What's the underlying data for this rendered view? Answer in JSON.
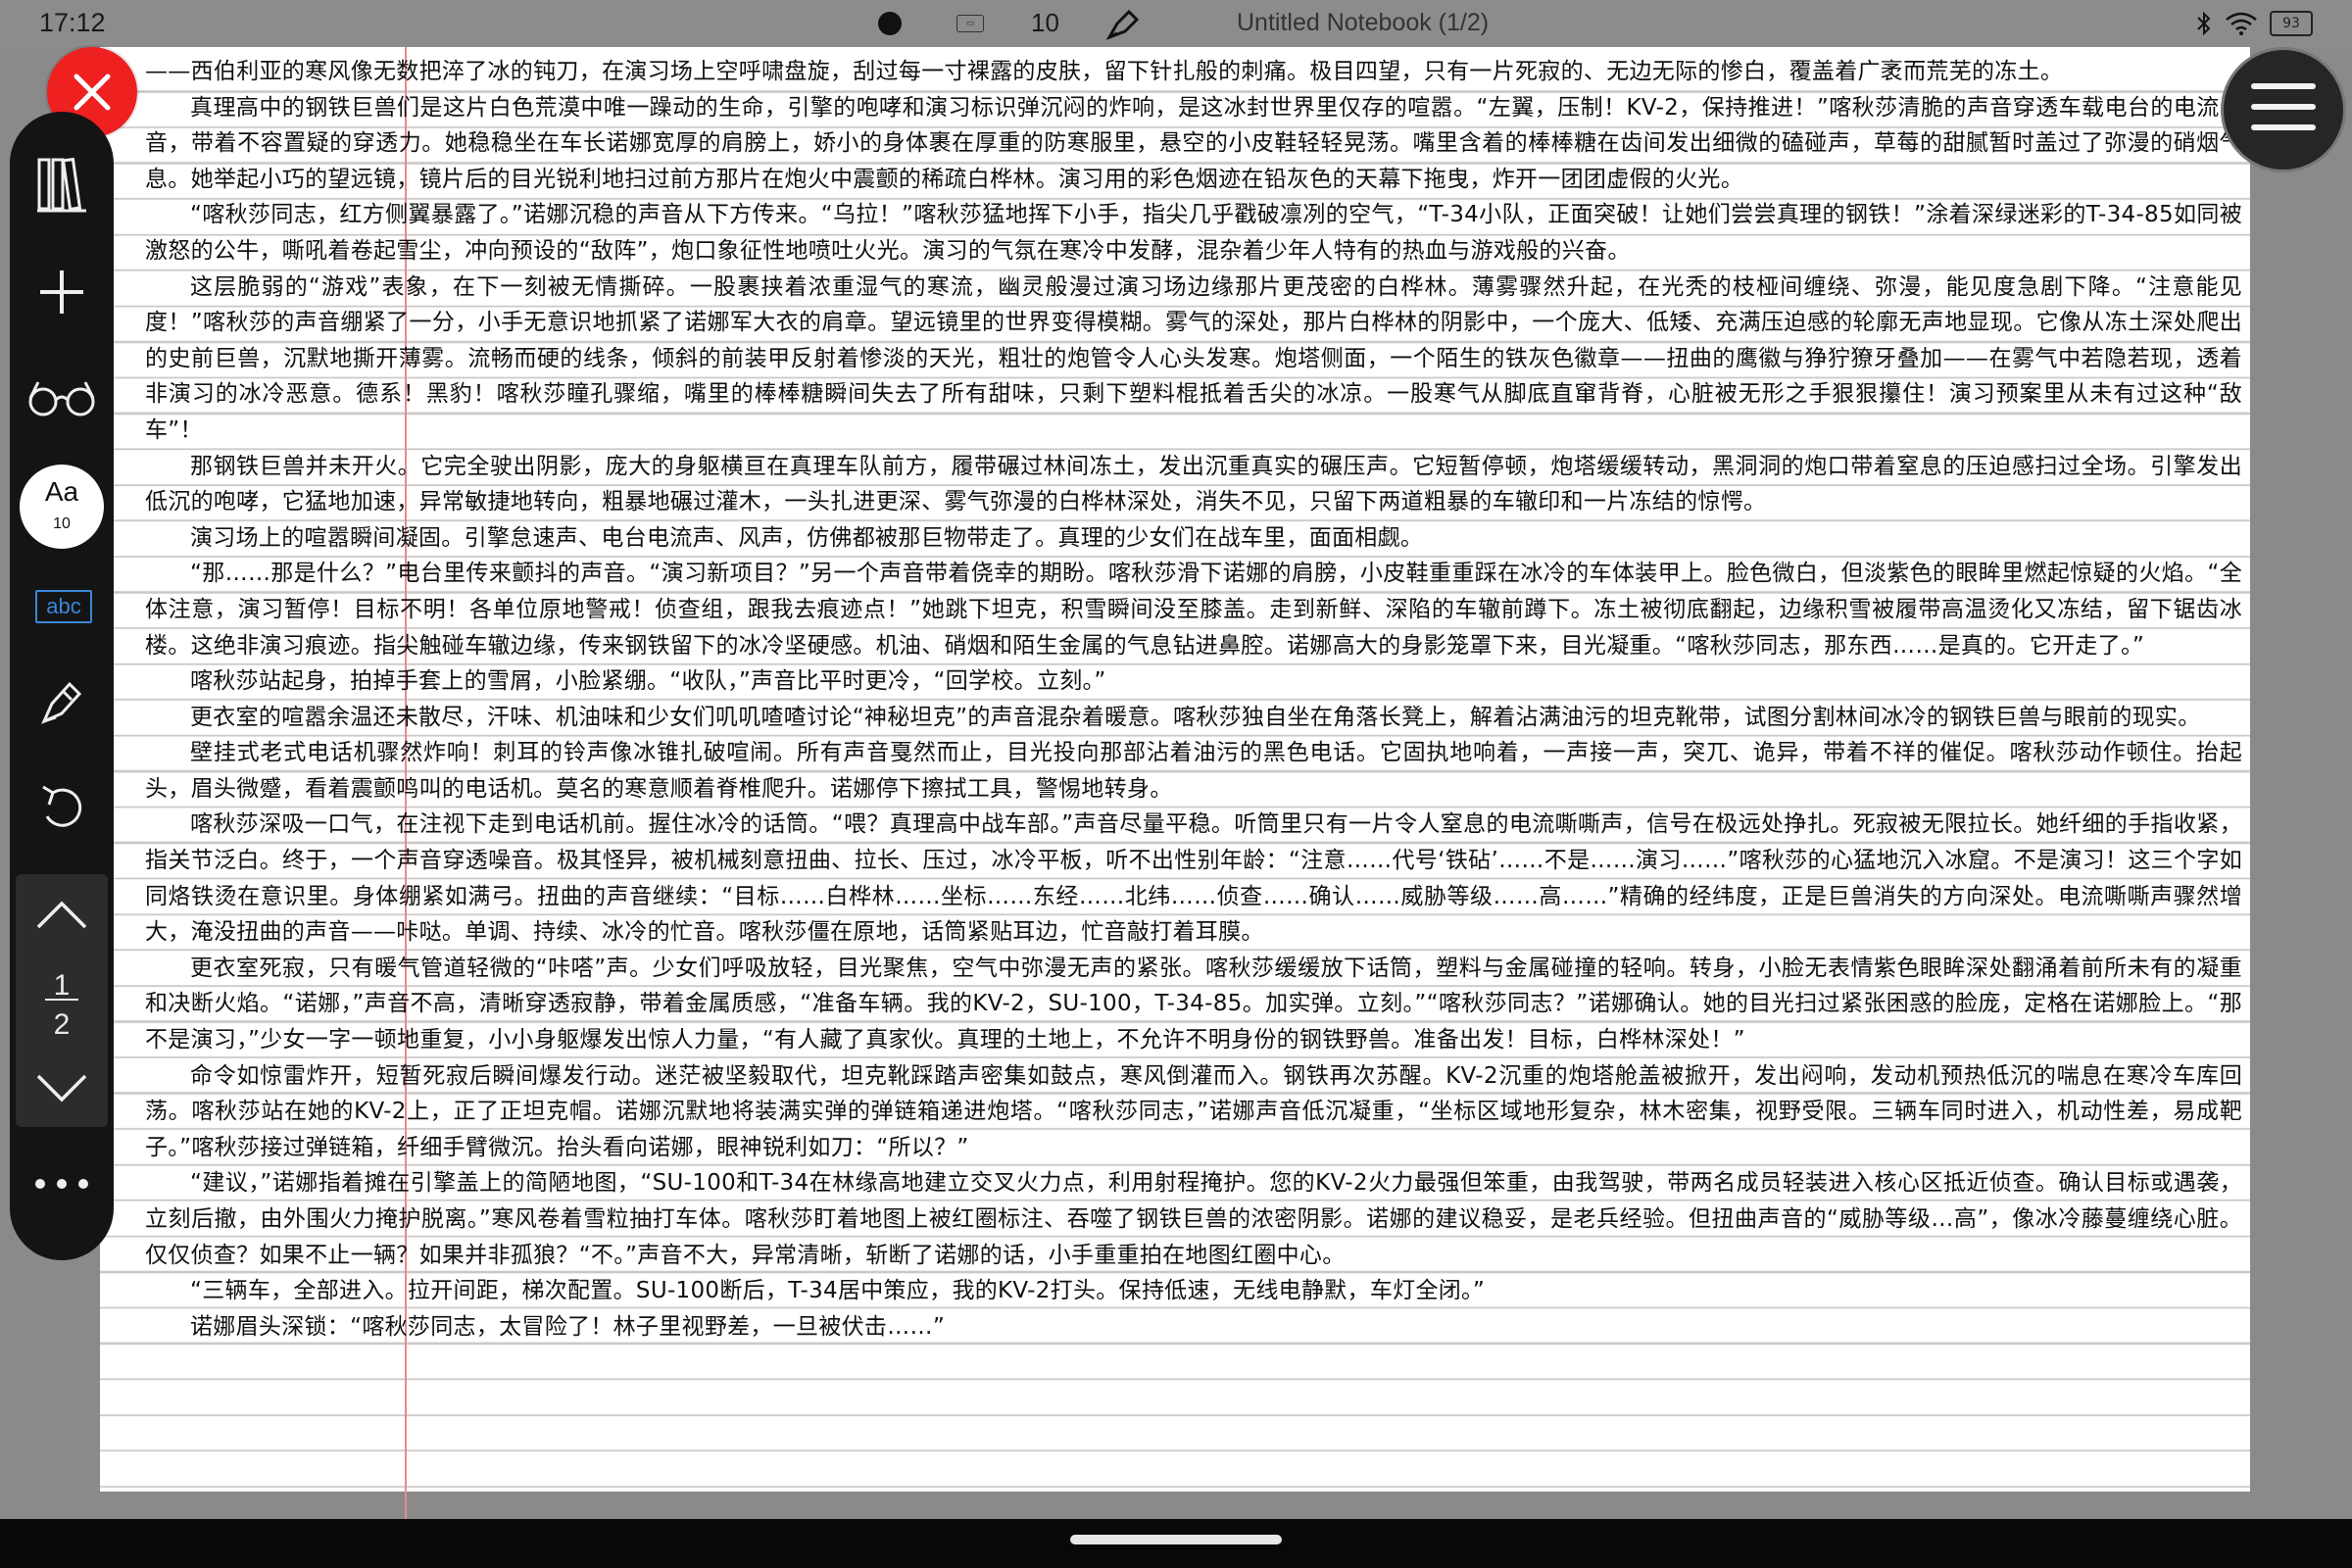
{
  "status": {
    "time": "17:12",
    "pen_count": "10",
    "notebook_title": "Untitled Notebook (1/2)",
    "battery": "93"
  },
  "toolbar": {
    "font_label": "Aa",
    "font_size": "10",
    "text_mode_label": "abc",
    "page_current": "1",
    "page_total": "2"
  },
  "colors": {
    "close": "#ee2020",
    "margin_line": "#e88b8b",
    "accent": "#3b86d6"
  },
  "icons": [
    "close-icon",
    "menu-icon",
    "library-icon",
    "add-icon",
    "glasses-icon",
    "pen-icon",
    "undo-icon",
    "chevron-up-icon",
    "chevron-down-icon",
    "more-icon",
    "bluetooth-icon",
    "wifi-icon",
    "battery-icon",
    "keyboard-icon"
  ],
  "document": {
    "paragraphs": [
      "——西伯利亚的寒风像无数把淬了冰的钝刀，在演习场上空呼啸盘旋，刮过每一寸裸露的皮肤，留下针扎般的刺痛。极目四望，只有一片死寂的、无边无际的惨白，覆盖着广袤而荒芜的冻土。",
      "真理高中的钢铁巨兽们是这片白色荒漠中唯一躁动的生命，引擎的咆哮和演习标识弹沉闷的炸响，是这冰封世界里仅存的喧嚣。“左翼，压制！KV-2，保持推进！”喀秋莎清脆的声音穿透车载电台的电流杂音，带着不容置疑的穿透力。她稳稳坐在车长诺娜宽厚的肩膀上，娇小的身体裹在厚重的防寒服里，悬空的小皮鞋轻轻晃荡。嘴里含着的棒棒糖在齿间发出细微的磕碰声，草莓的甜腻暂时盖过了弥漫的硝烟气息。她举起小巧的望远镜，镜片后的目光锐利地扫过前方那片在炮火中震颤的稀疏白桦林。演习用的彩色烟迹在铅灰色的天幕下拖曳，炸开一团团虚假的火光。",
      "“喀秋莎同志，红方侧翼暴露了。”诺娜沉稳的声音从下方传来。“乌拉！”喀秋莎猛地挥下小手，指尖几乎戳破凛冽的空气，“T-34小队，正面突破！让她们尝尝真理的钢铁！”涂着深绿迷彩的T-34-85如同被激怒的公牛，嘶吼着卷起雪尘，冲向预设的“敌阵”，炮口象征性地喷吐火光。演习的气氛在寒冷中发酵，混杂着少年人特有的热血与游戏般的兴奋。",
      "这层脆弱的“游戏”表象，在下一刻被无情撕碎。一股裹挟着浓重湿气的寒流，幽灵般漫过演习场边缘那片更茂密的白桦林。薄雾骤然升起，在光秃的枝桠间缠绕、弥漫，能见度急剧下降。“注意能见度！”喀秋莎的声音绷紧了一分，小手无意识地抓紧了诺娜军大衣的肩章。望远镜里的世界变得模糊。雾气的深处，那片白桦林的阴影中，一个庞大、低矮、充满压迫感的轮廓无声地显现。它像从冻土深处爬出的史前巨兽，沉默地撕开薄雾。流畅而硬的线条，倾斜的前装甲反射着惨淡的天光，粗壮的炮管令人心头发寒。炮塔侧面，一个陌生的铁灰色徽章——扭曲的鹰徽与狰狞獠牙叠加——在雾气中若隐若现，透着非演习的冰冷恶意。德系！黑豹！喀秋莎瞳孔骤缩，嘴里的棒棒糖瞬间失去了所有甜味，只剩下塑料棍抵着舌尖的冰凉。一股寒气从脚底直窜背脊，心脏被无形之手狠狠攥住！演习预案里从未有过这种“敌车”！",
      "那钢铁巨兽并未开火。它完全驶出阴影，庞大的身躯横亘在真理车队前方，履带碾过林间冻土，发出沉重真实的碾压声。它短暂停顿，炮塔缓缓转动，黑洞洞的炮口带着窒息的压迫感扫过全场。引擎发出低沉的咆哮，它猛地加速，异常敏捷地转向，粗暴地碾过灌木，一头扎进更深、雾气弥漫的白桦林深处，消失不见，只留下两道粗暴的车辙印和一片冻结的惊愕。",
      "演习场上的喧嚣瞬间凝固。引擎怠速声、电台电流声、风声，仿佛都被那巨物带走了。真理的少女们在战车里，面面相觑。",
      "“那……那是什么？”电台里传来颤抖的声音。“演习新项目？”另一个声音带着侥幸的期盼。喀秋莎滑下诺娜的肩膀，小皮鞋重重踩在冰冷的车体装甲上。脸色微白，但淡紫色的眼眸里燃起惊疑的火焰。“全体注意，演习暂停！目标不明！各单位原地警戒！侦查组，跟我去痕迹点！”她跳下坦克，积雪瞬间没至膝盖。走到新鲜、深陷的车辙前蹲下。冻土被彻底翻起，边缘积雪被履带高温烫化又冻结，留下锯齿冰楼。这绝非演习痕迹。指尖触碰车辙边缘，传来钢铁留下的冰冷坚硬感。机油、硝烟和陌生金属的气息钻进鼻腔。诺娜高大的身影笼罩下来，目光凝重。“喀秋莎同志，那东西……是真的。它开走了。”",
      "喀秋莎站起身，拍掉手套上的雪屑，小脸紧绷。“收队，”声音比平时更冷，“回学校。立刻。”",
      "更衣室的喧嚣余温还未散尽，汗味、机油味和少女们叽叽喳喳讨论“神秘坦克”的声音混杂着暖意。喀秋莎独自坐在角落长凳上，解着沾满油污的坦克靴带，试图分割林间冰冷的钢铁巨兽与眼前的现实。",
      "壁挂式老式电话机骤然炸响！刺耳的铃声像冰锥扎破喧闹。所有声音戛然而止，目光投向那部沾着油污的黑色电话。它固执地响着，一声接一声，突兀、诡异，带着不祥的催促。喀秋莎动作顿住。抬起头，眉头微蹙，看着震颤鸣叫的电话机。莫名的寒意顺着脊椎爬升。诺娜停下擦拭工具，警惕地转身。",
      "喀秋莎深吸一口气，在注视下走到电话机前。握住冰冷的话筒。“喂？真理高中战车部。”声音尽量平稳。听筒里只有一片令人窒息的电流嘶嘶声，信号在极远处挣扎。死寂被无限拉长。她纤细的手指收紧，指关节泛白。终于，一个声音穿透噪音。极其怪异，被机械刻意扭曲、拉长、压过，冰冷平板，听不出性别年龄：“注意……代号‘铁砧’……不是……演习……”喀秋莎的心猛地沉入冰窟。不是演习！这三个字如同烙铁烫在意识里。身体绷紧如满弓。扭曲的声音继续：“目标……白桦林……坐标……东经……北纬……侦查……确认……威胁等级……高……”精确的经纬度，正是巨兽消失的方向深处。电流嘶嘶声骤然增大，淹没扭曲的声音——咔哒。单调、持续、冰冷的忙音。喀秋莎僵在原地，话筒紧贴耳边，忙音敲打着耳膜。",
      "更衣室死寂，只有暖气管道轻微的“咔嗒”声。少女们呼吸放轻，目光聚焦，空气中弥漫无声的紧张。喀秋莎缓缓放下话筒，塑料与金属碰撞的轻响。转身，小脸无表情紫色眼眸深处翻涌着前所未有的凝重和决断火焰。“诺娜，”声音不高，清晰穿透寂静，带着金属质感，“准备车辆。我的KV-2，SU-100，T-34-85。加实弹。立刻。”“喀秋莎同志？”诺娜确认。她的目光扫过紧张困惑的脸庞，定格在诺娜脸上。“那不是演习，”少女一字一顿地重复，小小身躯爆发出惊人力量，“有人藏了真家伙。真理的土地上，不允许不明身份的钢铁野兽。准备出发！目标，白桦林深处！”",
      "命令如惊雷炸开，短暂死寂后瞬间爆发行动。迷茫被坚毅取代，坦克靴踩踏声密集如鼓点，寒风倒灌而入。钢铁再次苏醒。KV-2沉重的炮塔舱盖被掀开，发出闷响，发动机预热低沉的喘息在寒冷车库回荡。喀秋莎站在她的KV-2上，正了正坦克帽。诺娜沉默地将装满实弹的弹链箱递进炮塔。“喀秋莎同志，”诺娜声音低沉凝重，“坐标区域地形复杂，林木密集，视野受限。三辆车同时进入，机动性差，易成靶子。”喀秋莎接过弹链箱，纤细手臂微沉。抬头看向诺娜，眼神锐利如刀：“所以？”",
      "“建议，”诺娜指着摊在引擎盖上的简陋地图，“SU-100和T-34在林缘高地建立交叉火力点，利用射程掩护。您的KV-2火力最强但笨重，由我驾驶，带两名成员轻装进入核心区抵近侦查。确认目标或遇袭，立刻后撤，由外围火力掩护脱离。”寒风卷着雪粒抽打车体。喀秋莎盯着地图上被红圈标注、吞噬了钢铁巨兽的浓密阴影。诺娜的建议稳妥，是老兵经验。但扭曲声音的“威胁等级…高”，像冰冷藤蔓缠绕心脏。仅仅侦查？如果不止一辆？如果并非孤狼？“不。”声音不大，异常清晰，斩断了诺娜的话，小手重重拍在地图红圈中心。",
      "“三辆车，全部进入。拉开间距，梯次配置。SU-100断后，T-34居中策应，我的KV-2打头。保持低速，无线电静默，车灯全闭。”",
      "诺娜眉头深锁：“喀秋莎同志，太冒险了！林子里视野差，一旦被伏击……”"
    ]
  }
}
